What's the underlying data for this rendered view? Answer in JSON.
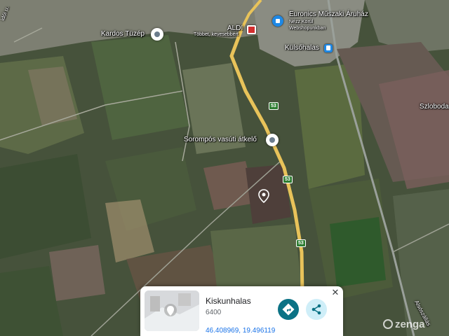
{
  "map": {
    "places": {
      "kardos": "Kardos Tüzép",
      "aldi": "ALDI",
      "aldi_sub": "Többet, kevesebbért",
      "euronics": "Euronics Műszaki Áruház",
      "euronics_sub1": "Nézz Körül",
      "euronics_sub2": "Webshopunkban",
      "kulsohalas": "Külsőhalas",
      "szloboda": "Szloboda",
      "sorompos": "Sorompós vasúti átkelő",
      "street_nw": "idói u.",
      "street_se": "Alsószállás"
    },
    "road_shields": [
      "53",
      "53",
      "53"
    ]
  },
  "card": {
    "title": "Kiskunhalas",
    "postcode": "6400",
    "coords": "46.408969, 19.496119"
  },
  "watermark": "zenga",
  "colors": {
    "road_major": "#e8c35a",
    "road_shield": "#2e7d32",
    "directions_button": "#0b7285",
    "share_button_bg": "#cfeef8",
    "coords_link": "#1a73e8",
    "aldi_icon": "#d32f2f",
    "store_icon": "#1e88e5"
  }
}
